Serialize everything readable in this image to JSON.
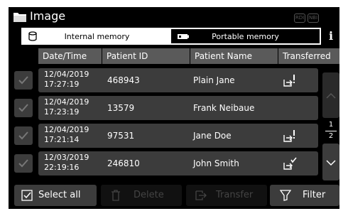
{
  "title": "Image",
  "badges": [
    "RDI",
    "NBI"
  ],
  "tabs": [
    {
      "label": "Internal memory",
      "active": true,
      "icon": "database-icon"
    },
    {
      "label": "Portable memory",
      "active": false,
      "icon": "usb-drive-icon"
    }
  ],
  "info_icon": "i",
  "columns": [
    "Date/Time",
    "Patient ID",
    "Patient Name",
    "Transferred"
  ],
  "rows": [
    {
      "date": "12/04/2019",
      "time": "17:27:19",
      "patient_id": "468943",
      "patient_name": "Plain Jane",
      "transferred": "transfer-warning-icon"
    },
    {
      "date": "12/04/2019",
      "time": "17:23:19",
      "patient_id": "13579",
      "patient_name": "Frank Neibaue",
      "transferred": ""
    },
    {
      "date": "12/04/2019",
      "time": "17:21:14",
      "patient_id": "97531",
      "patient_name": "Jane Doe",
      "transferred": "transfer-warning-icon"
    },
    {
      "date": "12/03/2019",
      "time": "22:19:16",
      "patient_id": "246810",
      "patient_name": "John Smith",
      "transferred": "transfer-done-icon"
    }
  ],
  "pagination": {
    "current": "1",
    "total": "2"
  },
  "buttons": {
    "select_all": "Select all",
    "delete": "Delete",
    "transfer": "Transfer",
    "filter": "Filter"
  },
  "colors": {
    "background": "#000000",
    "header": "#5a5a5a",
    "row": "#3c3c3c",
    "disabled_text": "#444444"
  }
}
